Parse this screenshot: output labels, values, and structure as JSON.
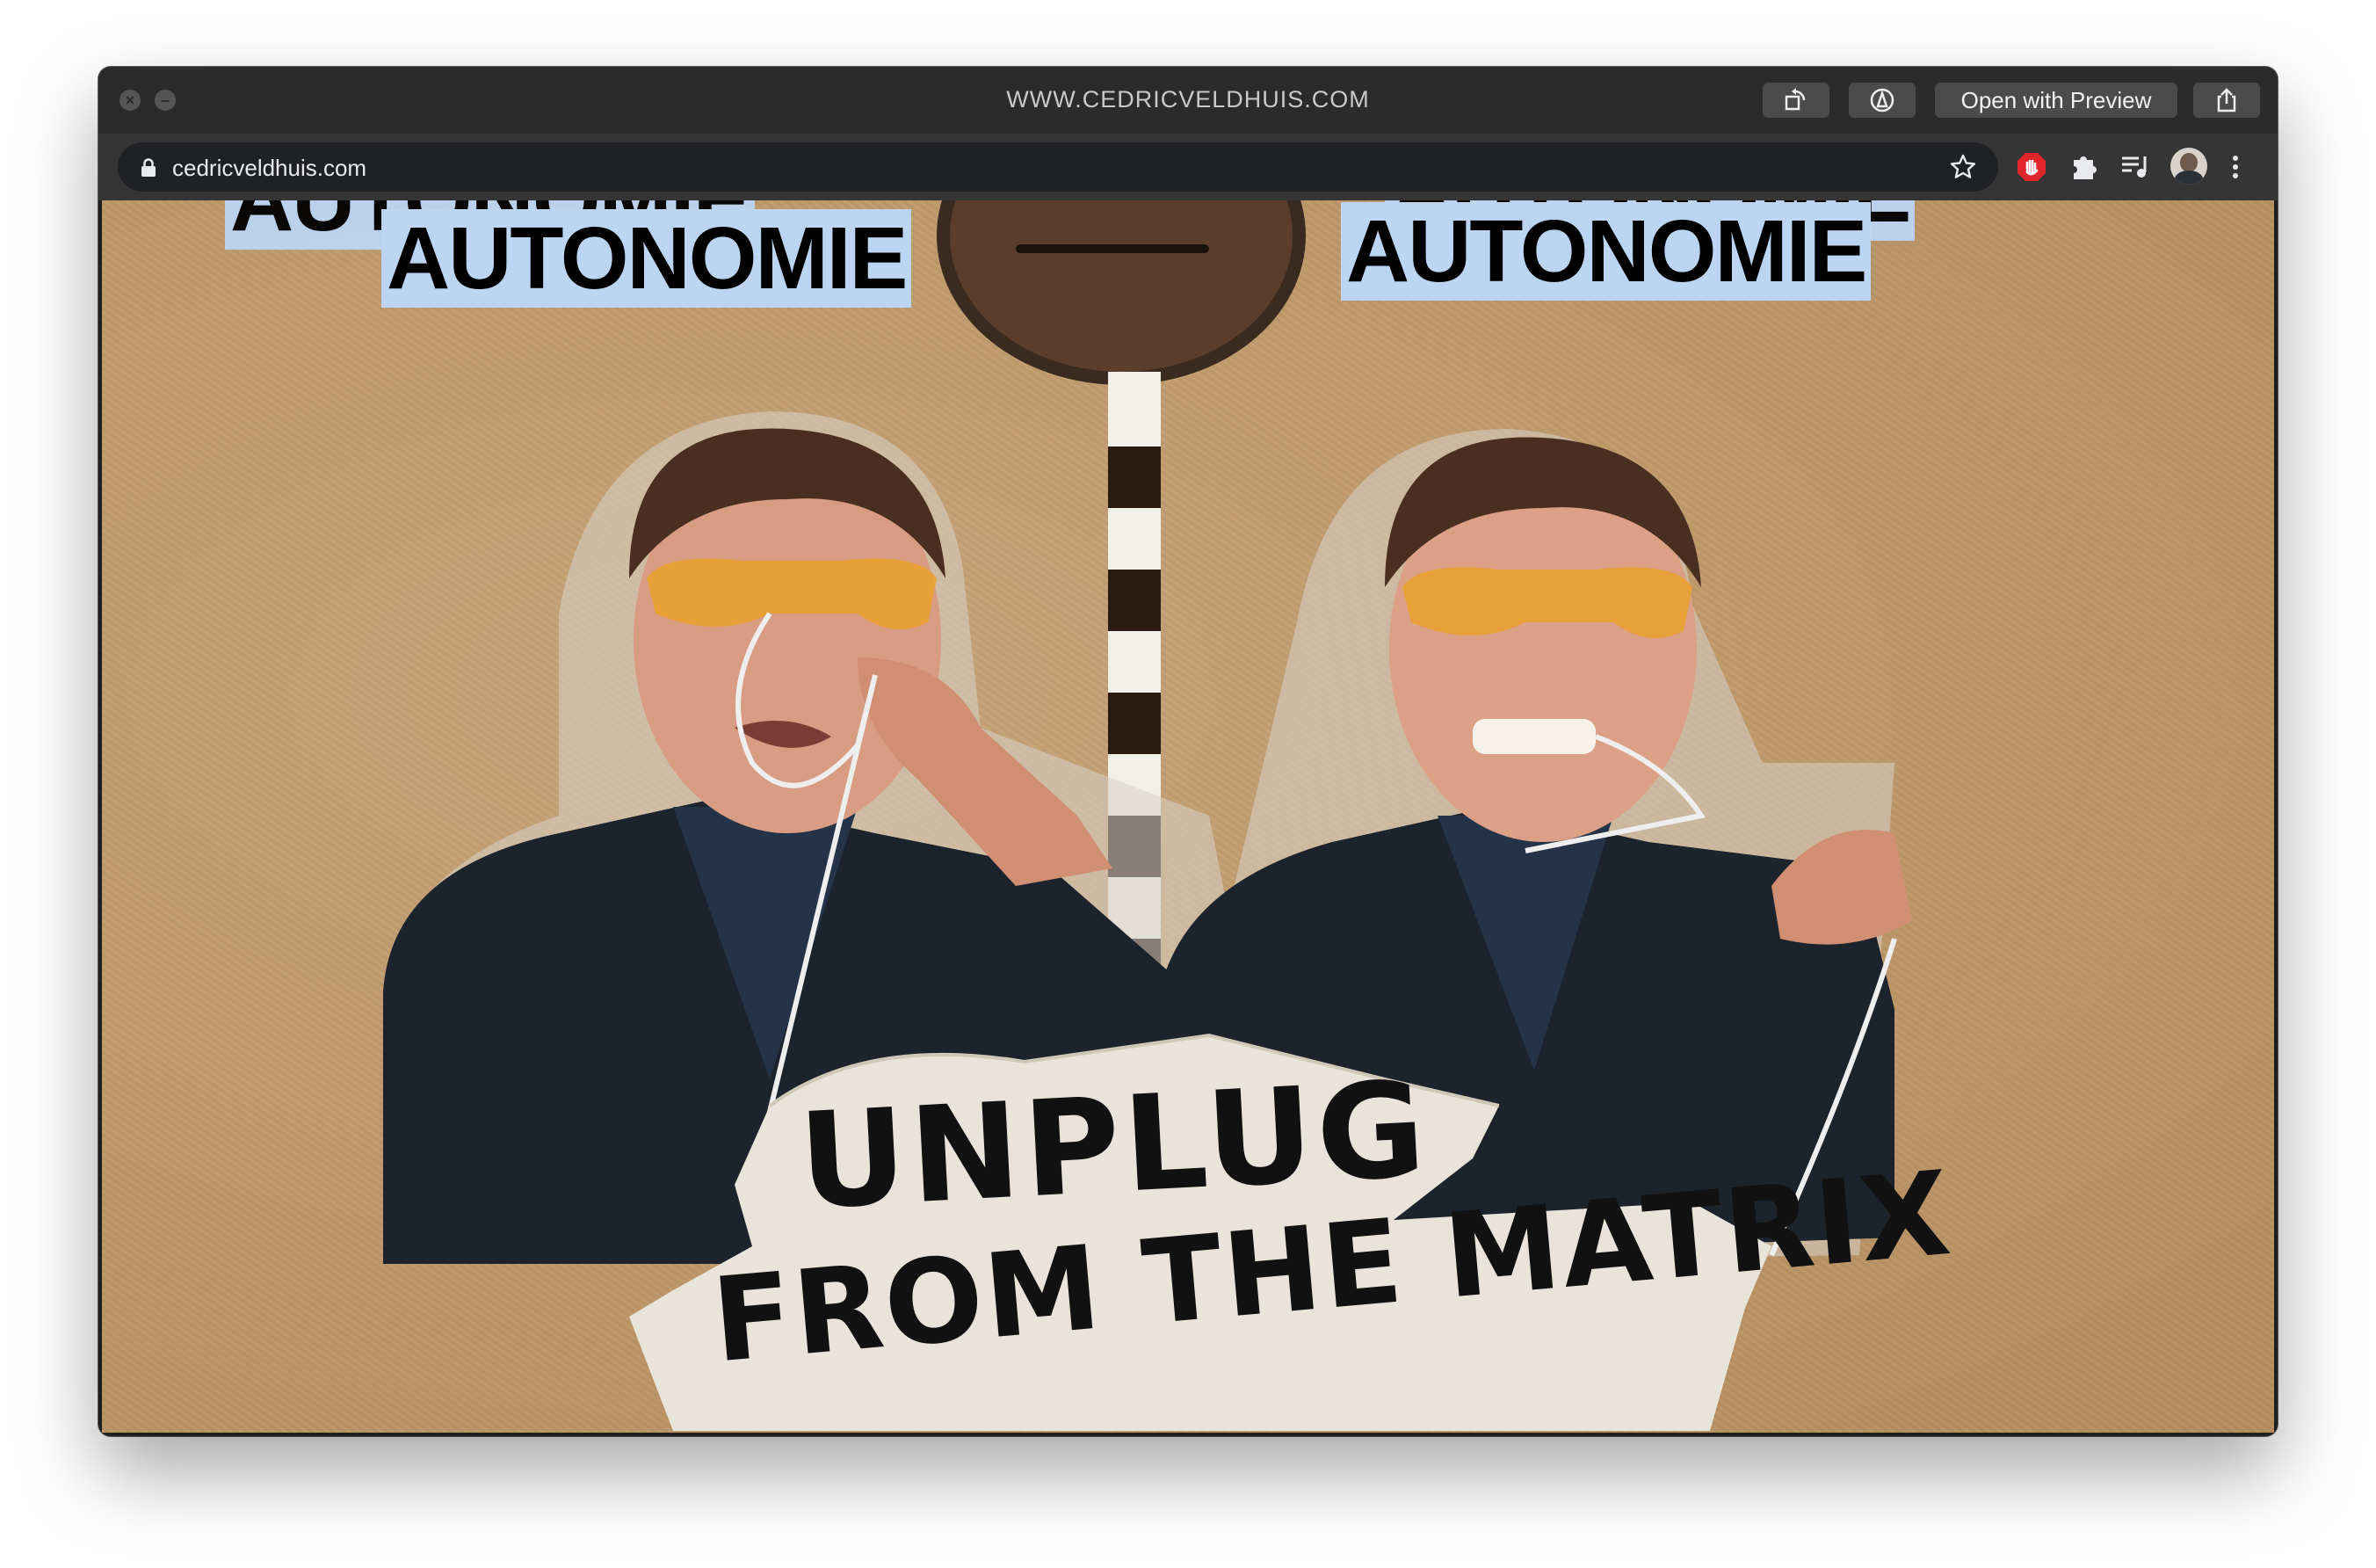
{
  "window": {
    "title": "WWW.CEDRICVELDHUIS.COM",
    "open_with_preview_label": "Open with Preview",
    "controls": [
      "close-icon",
      "minimize-icon",
      "rotate-icon",
      "markup-icon",
      "share-icon"
    ]
  },
  "browser": {
    "url": "cedricveldhuis.com",
    "icons": [
      "lock-icon",
      "bookmark-star-icon",
      "adblock-icon",
      "extensions-puzzle-icon",
      "media-control-icon",
      "profile-avatar",
      "menu-dots-icon"
    ]
  },
  "page": {
    "headline_left": "AUTONOMIE",
    "headline_right": "AUTONOMIE",
    "torn_label_line1": "UNPLUG",
    "torn_label_line2": "FROM THE MATRIX"
  },
  "colors": {
    "cardboard": "#c4a073",
    "highlight": "#bcd5f3",
    "paper": "#e9e4d9",
    "jacket": "#1c232c",
    "glasses": "#e9a12a"
  }
}
